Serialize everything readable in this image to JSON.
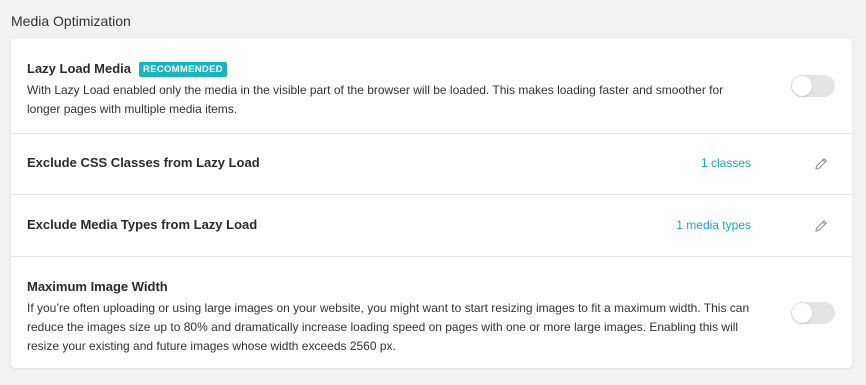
{
  "section": {
    "title": "Media Optimization"
  },
  "rows": {
    "lazy_load": {
      "title": "Lazy Load Media",
      "badge": "RECOMMENDED",
      "description": "With Lazy Load enabled only the media in the visible part of the browser will be loaded. This makes loading faster and smoother for longer pages with multiple media items.",
      "enabled": false
    },
    "exclude_css": {
      "title": "Exclude CSS Classes from Lazy Load",
      "count_label": "1 classes",
      "icon": "pencil-icon"
    },
    "exclude_media": {
      "title": "Exclude Media Types from Lazy Load",
      "count_label": "1 media types",
      "icon": "pencil-icon"
    },
    "max_width": {
      "title": "Maximum Image Width",
      "description": "If you’re often uploading or using large images on your website, you might want to start resizing images to fit a maximum width. This can reduce the images size up to 80% and dramatically increase loading speed on pages with one or more large images. Enabling this will resize your existing and future images whose width exceeds 2560 px.",
      "enabled": false
    }
  },
  "colors": {
    "accent": "#17a8b8",
    "badge": "#17b5bf",
    "toggle_off": "#e4e4e4"
  }
}
